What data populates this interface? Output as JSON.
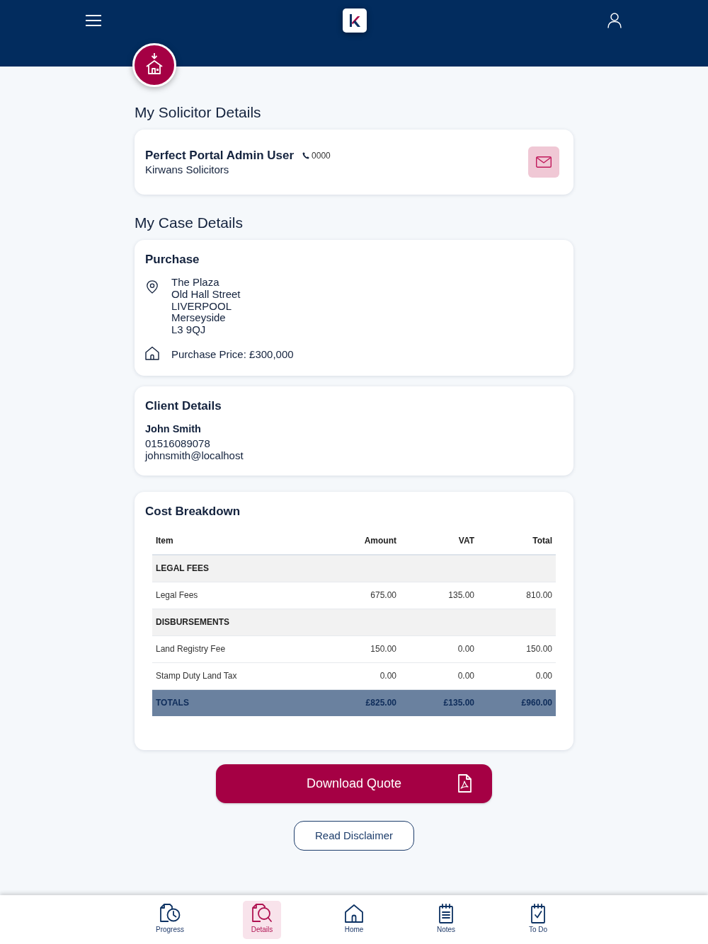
{
  "solicitor": {
    "heading": "My Solicitor Details",
    "name": "Perfect Portal Admin User",
    "phone": "0000",
    "firm": "Kirwans Solicitors"
  },
  "case": {
    "heading": "My Case Details",
    "purchase": {
      "title": "Purchase",
      "address": [
        "The Plaza",
        "Old Hall Street",
        "LIVERPOOL",
        "Merseyside",
        "L3 9QJ"
      ],
      "price": "Purchase Price: £300,000"
    },
    "client": {
      "title": "Client Details",
      "name": "John Smith",
      "phone": "01516089078",
      "email": "johnsmith@localhost"
    },
    "costs": {
      "title": "Cost Breakdown",
      "columns": [
        "Item",
        "Amount",
        "VAT",
        "Total"
      ],
      "rows": [
        {
          "kind": "section",
          "cells": [
            {
              "text": "LEGAL FEES",
              "colspan": 4
            }
          ]
        },
        {
          "kind": "item",
          "cells": [
            "Legal Fees",
            "675.00",
            "135.00",
            "810.00"
          ]
        },
        {
          "kind": "section",
          "cells": [
            {
              "text": "DISBURSEMENTS",
              "colspan": 4
            }
          ]
        },
        {
          "kind": "item",
          "cells": [
            "Land Registry Fee",
            "150.00",
            "0.00",
            "150.00"
          ]
        },
        {
          "kind": "item",
          "cells": [
            "Stamp Duty Land Tax",
            "0.00",
            "0.00",
            "0.00"
          ]
        },
        {
          "kind": "totals",
          "cells": [
            "TOTALS",
            "£825.00",
            "£135.00",
            "£960.00"
          ]
        }
      ]
    }
  },
  "actions": [
    {
      "kind": "primary",
      "label": "Download Quote"
    },
    {
      "kind": "outline",
      "label": "Read Disclaimer"
    }
  ],
  "bottom_nav": [
    {
      "label": "Progress",
      "selected": false
    },
    {
      "label": "Details",
      "selected": true
    },
    {
      "label": "Home",
      "selected": false
    },
    {
      "label": "Notes",
      "selected": false
    },
    {
      "label": "To Do",
      "selected": false
    }
  ]
}
